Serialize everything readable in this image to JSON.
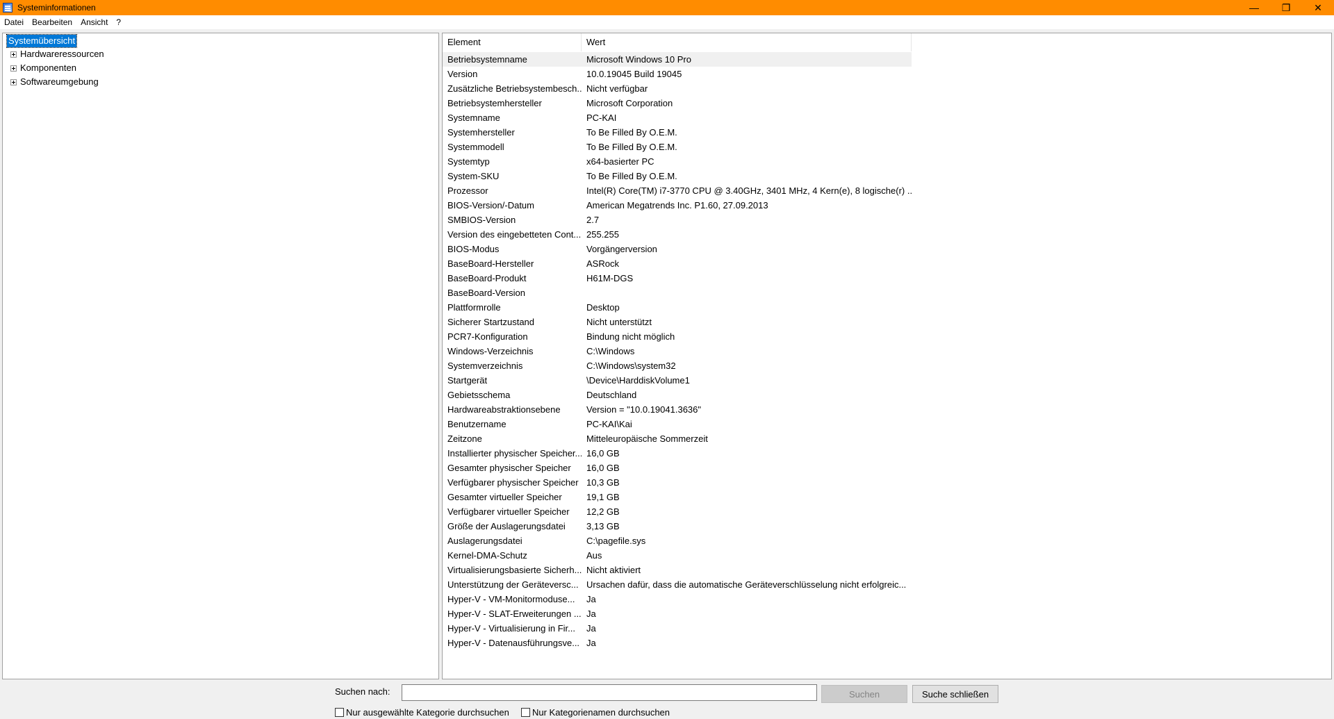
{
  "window": {
    "title": "Systeminformationen",
    "controls": {
      "minimize": "—",
      "restore": "❐",
      "close": "✕"
    }
  },
  "menu": [
    "Datei",
    "Bearbeiten",
    "Ansicht",
    "?"
  ],
  "tree": {
    "root": "Systemübersicht",
    "children": [
      "Hardwareressourcen",
      "Komponenten",
      "Softwareumgebung"
    ]
  },
  "table": {
    "headers": {
      "element": "Element",
      "value": "Wert"
    },
    "rows": [
      [
        "Betriebsystemname",
        "Microsoft Windows 10 Pro"
      ],
      [
        "Version",
        "10.0.19045 Build 19045"
      ],
      [
        "Zusätzliche Betriebsystembesch...",
        "Nicht verfügbar"
      ],
      [
        "Betriebsystemhersteller",
        "Microsoft Corporation"
      ],
      [
        "Systemname",
        "PC-KAI"
      ],
      [
        "Systemhersteller",
        "To Be Filled By O.E.M."
      ],
      [
        "Systemmodell",
        "To Be Filled By O.E.M."
      ],
      [
        "Systemtyp",
        "x64-basierter PC"
      ],
      [
        "System-SKU",
        "To Be Filled By O.E.M."
      ],
      [
        "Prozessor",
        "Intel(R) Core(TM) i7-3770 CPU @ 3.40GHz, 3401 MHz, 4 Kern(e), 8 logische(r) ..."
      ],
      [
        "BIOS-Version/-Datum",
        "American Megatrends Inc. P1.60, 27.09.2013"
      ],
      [
        "SMBIOS-Version",
        "2.7"
      ],
      [
        "Version des eingebetteten Cont...",
        "255.255"
      ],
      [
        "BIOS-Modus",
        "Vorgängerversion"
      ],
      [
        "BaseBoard-Hersteller",
        "ASRock"
      ],
      [
        "BaseBoard-Produkt",
        "H61M-DGS"
      ],
      [
        "BaseBoard-Version",
        ""
      ],
      [
        "Plattformrolle",
        "Desktop"
      ],
      [
        "Sicherer Startzustand",
        "Nicht unterstützt"
      ],
      [
        "PCR7-Konfiguration",
        "Bindung nicht möglich"
      ],
      [
        "Windows-Verzeichnis",
        "C:\\Windows"
      ],
      [
        "Systemverzeichnis",
        "C:\\Windows\\system32"
      ],
      [
        "Startgerät",
        "\\Device\\HarddiskVolume1"
      ],
      [
        "Gebietsschema",
        "Deutschland"
      ],
      [
        "Hardwareabstraktionsebene",
        "Version = \"10.0.19041.3636\""
      ],
      [
        "Benutzername",
        "PC-KAI\\Kai"
      ],
      [
        "Zeitzone",
        "Mitteleuropäische Sommerzeit"
      ],
      [
        "Installierter physischer Speicher...",
        "16,0 GB"
      ],
      [
        "Gesamter physischer Speicher",
        "16,0 GB"
      ],
      [
        "Verfügbarer physischer Speicher",
        "10,3 GB"
      ],
      [
        "Gesamter virtueller Speicher",
        "19,1 GB"
      ],
      [
        "Verfügbarer virtueller Speicher",
        "12,2 GB"
      ],
      [
        "Größe der Auslagerungsdatei",
        "3,13 GB"
      ],
      [
        "Auslagerungsdatei",
        "C:\\pagefile.sys"
      ],
      [
        "Kernel-DMA-Schutz",
        "Aus"
      ],
      [
        "Virtualisierungsbasierte Sicherh...",
        "Nicht aktiviert"
      ],
      [
        "Unterstützung der Geräteversc...",
        "Ursachen dafür, dass die automatische Geräteverschlüsselung nicht erfolgreic..."
      ],
      [
        "Hyper-V - VM-Monitormoduse...",
        "Ja"
      ],
      [
        "Hyper-V - SLAT-Erweiterungen ...",
        "Ja"
      ],
      [
        "Hyper-V - Virtualisierung in Fir...",
        "Ja"
      ],
      [
        "Hyper-V - Datenausführungsve...",
        "Ja"
      ]
    ]
  },
  "search": {
    "label": "Suchen nach:",
    "value": "",
    "search_button": "Suchen",
    "close_button": "Suche schließen",
    "option_selected_category": "Nur ausgewählte Kategorie durchsuchen",
    "option_category_names": "Nur Kategorienamen durchsuchen"
  }
}
